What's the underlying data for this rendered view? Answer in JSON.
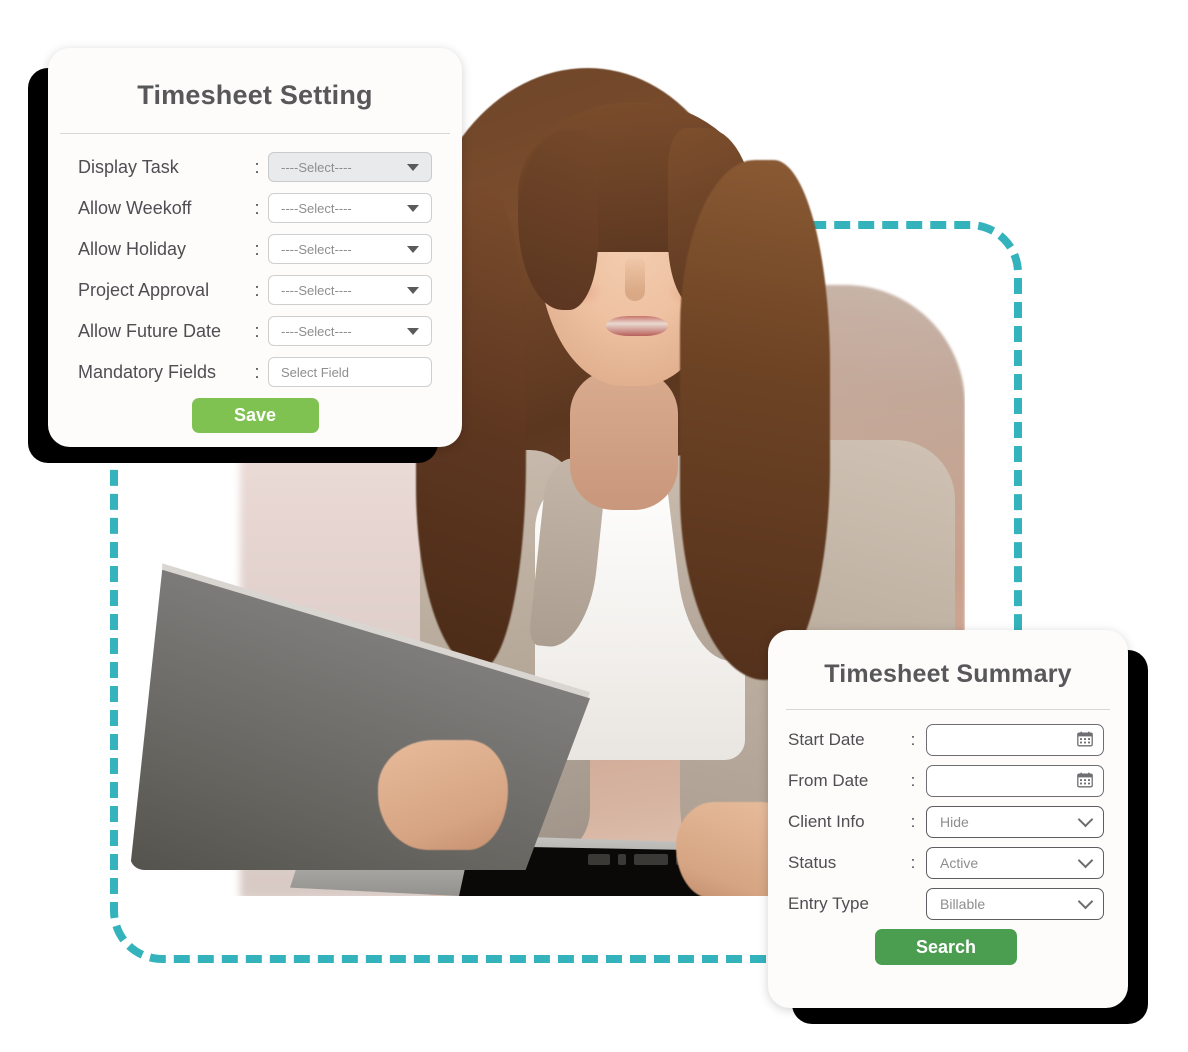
{
  "colors": {
    "teal_dashed": "#34b3bc",
    "save_green": "#7fc252",
    "search_green": "#4b9e4f",
    "card_bg": "#fdfcfb",
    "label_text": "#4f4e52",
    "placeholder_text": "#8e8e90"
  },
  "timesheet_setting": {
    "title": "Timesheet Setting",
    "colon": ":",
    "rows": [
      {
        "label": "Display Task",
        "value": "----Select----",
        "control": "select",
        "state": "filled"
      },
      {
        "label": "Allow Weekoff",
        "value": "----Select----",
        "control": "select",
        "state": "normal"
      },
      {
        "label": "Allow Holiday",
        "value": "----Select----",
        "control": "select",
        "state": "normal"
      },
      {
        "label": "Project Approval",
        "value": "----Select----",
        "control": "select",
        "state": "normal"
      },
      {
        "label": "Allow Future Date",
        "value": "----Select----",
        "control": "select",
        "state": "normal"
      },
      {
        "label": "Mandatory Fields",
        "value": "Select Field",
        "control": "text",
        "state": "normal"
      }
    ],
    "save_label": "Save"
  },
  "timesheet_summary": {
    "title": "Timesheet Summary",
    "colon": ":",
    "rows": [
      {
        "label": "Start Date",
        "value": "",
        "control": "date",
        "has_colon": true
      },
      {
        "label": "From Date",
        "value": "",
        "control": "date",
        "has_colon": true
      },
      {
        "label": "Client Info",
        "value": "Hide",
        "control": "select",
        "has_colon": true
      },
      {
        "label": "Status",
        "value": "Active",
        "control": "select",
        "has_colon": true
      },
      {
        "label": "Entry Type",
        "value": "Billable",
        "control": "select",
        "has_colon": false
      }
    ],
    "search_label": "Search",
    "calendar_glyph": "📅"
  }
}
